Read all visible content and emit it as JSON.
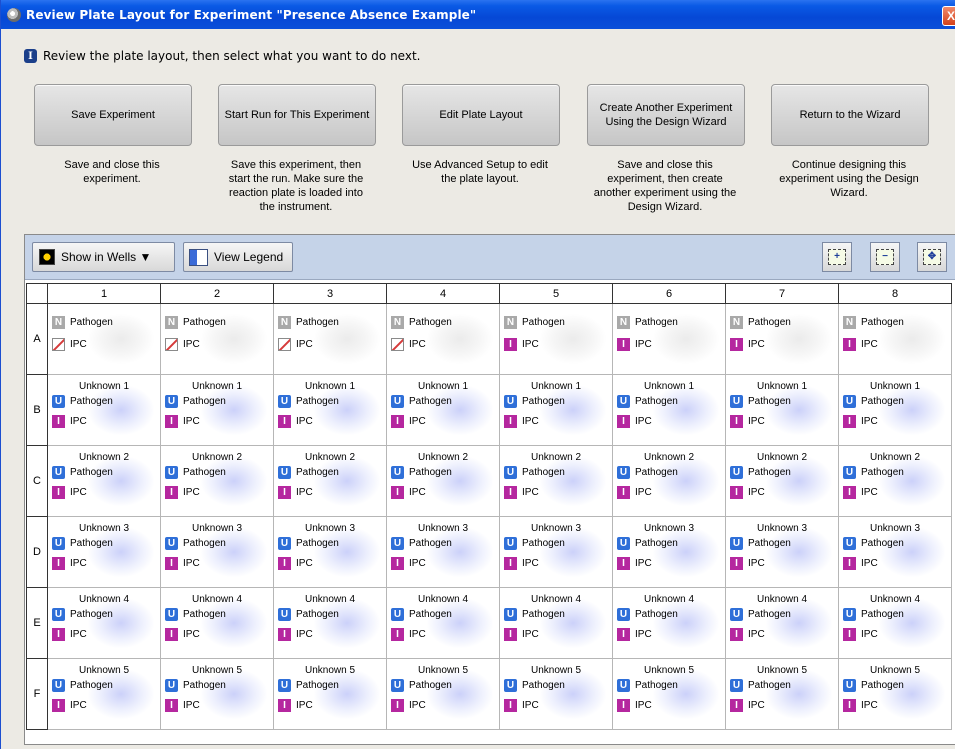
{
  "window": {
    "title": "Review Plate Layout for Experiment \"Presence Absence Example\"",
    "close_label": "X"
  },
  "info": {
    "icon_label": "I",
    "text": "Review the plate layout, then select what you want to do next."
  },
  "actions": [
    {
      "label": "Save Experiment",
      "desc": "Save and close this\nexperiment."
    },
    {
      "label": "Start Run for This Experiment",
      "desc": "Save this experiment, then\nstart the run. Make sure the\nreaction plate is loaded into\nthe instrument."
    },
    {
      "label": "Edit Plate Layout",
      "desc": "Use Advanced Setup to edit\nthe plate layout."
    },
    {
      "label": "Create Another Experiment\nUsing the Design Wizard",
      "desc": "Save and close this\nexperiment, then create\nanother experiment using the\nDesign Wizard."
    },
    {
      "label": "Return to the Wizard",
      "desc": "Continue designing this\nexperiment using the Design\nWizard."
    }
  ],
  "toolbar": {
    "show_in_wells": "Show in Wells ▼",
    "view_legend": "View Legend"
  },
  "grid": {
    "columns": [
      "1",
      "2",
      "3",
      "4",
      "5",
      "6",
      "7",
      "8"
    ],
    "rows": [
      {
        "label": "A",
        "wells": [
          {
            "sample": "",
            "target1": "Pathogen",
            "t1badge": "N",
            "target2": "IPC",
            "t2badge": "X"
          },
          {
            "sample": "",
            "target1": "Pathogen",
            "t1badge": "N",
            "target2": "IPC",
            "t2badge": "X"
          },
          {
            "sample": "",
            "target1": "Pathogen",
            "t1badge": "N",
            "target2": "IPC",
            "t2badge": "X"
          },
          {
            "sample": "",
            "target1": "Pathogen",
            "t1badge": "N",
            "target2": "IPC",
            "t2badge": "X"
          },
          {
            "sample": "",
            "target1": "Pathogen",
            "t1badge": "N",
            "target2": "IPC",
            "t2badge": "I"
          },
          {
            "sample": "",
            "target1": "Pathogen",
            "t1badge": "N",
            "target2": "IPC",
            "t2badge": "I"
          },
          {
            "sample": "",
            "target1": "Pathogen",
            "t1badge": "N",
            "target2": "IPC",
            "t2badge": "I"
          },
          {
            "sample": "",
            "target1": "Pathogen",
            "t1badge": "N",
            "target2": "IPC",
            "t2badge": "I"
          }
        ]
      },
      {
        "label": "B",
        "wells": [
          {
            "sample": "Unknown 1",
            "target1": "Pathogen",
            "t1badge": "U",
            "target2": "IPC",
            "t2badge": "I"
          },
          {
            "sample": "Unknown 1",
            "target1": "Pathogen",
            "t1badge": "U",
            "target2": "IPC",
            "t2badge": "I"
          },
          {
            "sample": "Unknown 1",
            "target1": "Pathogen",
            "t1badge": "U",
            "target2": "IPC",
            "t2badge": "I"
          },
          {
            "sample": "Unknown 1",
            "target1": "Pathogen",
            "t1badge": "U",
            "target2": "IPC",
            "t2badge": "I"
          },
          {
            "sample": "Unknown 1",
            "target1": "Pathogen",
            "t1badge": "U",
            "target2": "IPC",
            "t2badge": "I"
          },
          {
            "sample": "Unknown 1",
            "target1": "Pathogen",
            "t1badge": "U",
            "target2": "IPC",
            "t2badge": "I"
          },
          {
            "sample": "Unknown 1",
            "target1": "Pathogen",
            "t1badge": "U",
            "target2": "IPC",
            "t2badge": "I"
          },
          {
            "sample": "Unknown 1",
            "target1": "Pathogen",
            "t1badge": "U",
            "target2": "IPC",
            "t2badge": "I"
          }
        ]
      },
      {
        "label": "C",
        "wells": [
          {
            "sample": "Unknown 2",
            "target1": "Pathogen",
            "t1badge": "U",
            "target2": "IPC",
            "t2badge": "I"
          },
          {
            "sample": "Unknown 2",
            "target1": "Pathogen",
            "t1badge": "U",
            "target2": "IPC",
            "t2badge": "I"
          },
          {
            "sample": "Unknown 2",
            "target1": "Pathogen",
            "t1badge": "U",
            "target2": "IPC",
            "t2badge": "I"
          },
          {
            "sample": "Unknown 2",
            "target1": "Pathogen",
            "t1badge": "U",
            "target2": "IPC",
            "t2badge": "I"
          },
          {
            "sample": "Unknown 2",
            "target1": "Pathogen",
            "t1badge": "U",
            "target2": "IPC",
            "t2badge": "I"
          },
          {
            "sample": "Unknown 2",
            "target1": "Pathogen",
            "t1badge": "U",
            "target2": "IPC",
            "t2badge": "I"
          },
          {
            "sample": "Unknown 2",
            "target1": "Pathogen",
            "t1badge": "U",
            "target2": "IPC",
            "t2badge": "I"
          },
          {
            "sample": "Unknown 2",
            "target1": "Pathogen",
            "t1badge": "U",
            "target2": "IPC",
            "t2badge": "I"
          }
        ]
      },
      {
        "label": "D",
        "wells": [
          {
            "sample": "Unknown 3",
            "target1": "Pathogen",
            "t1badge": "U",
            "target2": "IPC",
            "t2badge": "I"
          },
          {
            "sample": "Unknown 3",
            "target1": "Pathogen",
            "t1badge": "U",
            "target2": "IPC",
            "t2badge": "I"
          },
          {
            "sample": "Unknown 3",
            "target1": "Pathogen",
            "t1badge": "U",
            "target2": "IPC",
            "t2badge": "I"
          },
          {
            "sample": "Unknown 3",
            "target1": "Pathogen",
            "t1badge": "U",
            "target2": "IPC",
            "t2badge": "I"
          },
          {
            "sample": "Unknown 3",
            "target1": "Pathogen",
            "t1badge": "U",
            "target2": "IPC",
            "t2badge": "I"
          },
          {
            "sample": "Unknown 3",
            "target1": "Pathogen",
            "t1badge": "U",
            "target2": "IPC",
            "t2badge": "I"
          },
          {
            "sample": "Unknown 3",
            "target1": "Pathogen",
            "t1badge": "U",
            "target2": "IPC",
            "t2badge": "I"
          },
          {
            "sample": "Unknown 3",
            "target1": "Pathogen",
            "t1badge": "U",
            "target2": "IPC",
            "t2badge": "I"
          }
        ]
      },
      {
        "label": "E",
        "wells": [
          {
            "sample": "Unknown 4",
            "target1": "Pathogen",
            "t1badge": "U",
            "target2": "IPC",
            "t2badge": "I"
          },
          {
            "sample": "Unknown 4",
            "target1": "Pathogen",
            "t1badge": "U",
            "target2": "IPC",
            "t2badge": "I"
          },
          {
            "sample": "Unknown 4",
            "target1": "Pathogen",
            "t1badge": "U",
            "target2": "IPC",
            "t2badge": "I"
          },
          {
            "sample": "Unknown 4",
            "target1": "Pathogen",
            "t1badge": "U",
            "target2": "IPC",
            "t2badge": "I"
          },
          {
            "sample": "Unknown 4",
            "target1": "Pathogen",
            "t1badge": "U",
            "target2": "IPC",
            "t2badge": "I"
          },
          {
            "sample": "Unknown 4",
            "target1": "Pathogen",
            "t1badge": "U",
            "target2": "IPC",
            "t2badge": "I"
          },
          {
            "sample": "Unknown 4",
            "target1": "Pathogen",
            "t1badge": "U",
            "target2": "IPC",
            "t2badge": "I"
          },
          {
            "sample": "Unknown 4",
            "target1": "Pathogen",
            "t1badge": "U",
            "target2": "IPC",
            "t2badge": "I"
          }
        ]
      },
      {
        "label": "F",
        "wells": [
          {
            "sample": "Unknown 5",
            "target1": "Pathogen",
            "t1badge": "U",
            "target2": "IPC",
            "t2badge": "I"
          },
          {
            "sample": "Unknown 5",
            "target1": "Pathogen",
            "t1badge": "U",
            "target2": "IPC",
            "t2badge": "I"
          },
          {
            "sample": "Unknown 5",
            "target1": "Pathogen",
            "t1badge": "U",
            "target2": "IPC",
            "t2badge": "I"
          },
          {
            "sample": "Unknown 5",
            "target1": "Pathogen",
            "t1badge": "U",
            "target2": "IPC",
            "t2badge": "I"
          },
          {
            "sample": "Unknown 5",
            "target1": "Pathogen",
            "t1badge": "U",
            "target2": "IPC",
            "t2badge": "I"
          },
          {
            "sample": "Unknown 5",
            "target1": "Pathogen",
            "t1badge": "U",
            "target2": "IPC",
            "t2badge": "I"
          },
          {
            "sample": "Unknown 5",
            "target1": "Pathogen",
            "t1badge": "U",
            "target2": "IPC",
            "t2badge": "I"
          },
          {
            "sample": "Unknown 5",
            "target1": "Pathogen",
            "t1badge": "U",
            "target2": "IPC",
            "t2badge": "I"
          }
        ]
      }
    ]
  },
  "badge_colors": {
    "N": "#a9a9a9",
    "U": "#2f6fd8",
    "I": "#b5279f",
    "X": "#d63b3b"
  }
}
